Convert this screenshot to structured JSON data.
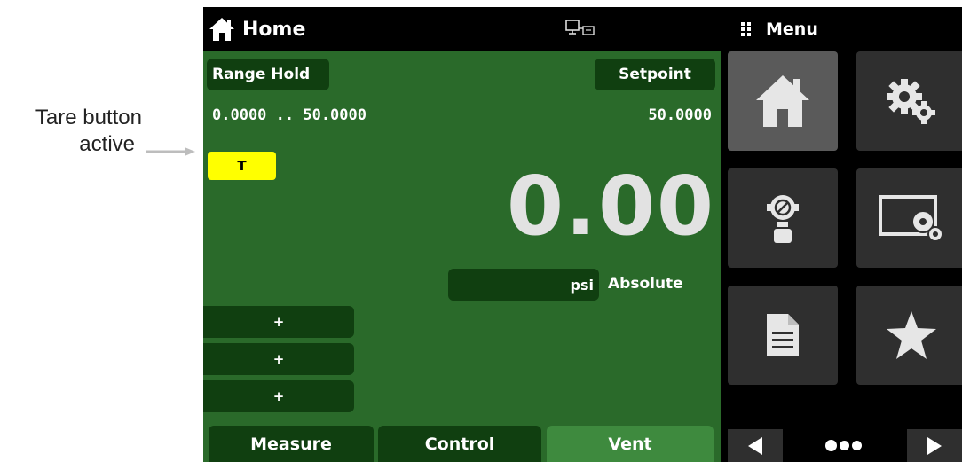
{
  "annotation": {
    "line1": "Tare button",
    "line2": "active"
  },
  "topbar": {
    "home_label": "Home",
    "home_icon": "home-icon",
    "network_icon": "network-icon",
    "menu_icon": "grid-dots-icon",
    "menu_label": "Menu"
  },
  "main": {
    "range_hold_label": "Range Hold",
    "setpoint_label": "Setpoint",
    "range_values": "0.0000 .. 50.0000",
    "setpoint_value": "50.0000",
    "tare_label": "T",
    "reading": "0.00",
    "unit": "psi",
    "mode": "Absolute",
    "plus_labels": [
      "+",
      "+",
      "+"
    ],
    "tabs": [
      {
        "label": "Measure"
      },
      {
        "label": "Control"
      },
      {
        "label": "Vent"
      }
    ]
  },
  "menu_tiles": [
    {
      "icon": "home-icon",
      "active": true
    },
    {
      "icon": "gears-icon"
    },
    {
      "icon": "sensor-icon"
    },
    {
      "icon": "display-settings-icon"
    },
    {
      "icon": "document-icon"
    },
    {
      "icon": "star-icon"
    }
  ],
  "pager": {
    "prev_icon": "triangle-left-icon",
    "next_icon": "triangle-right-icon",
    "dots_icon": "page-dots-icon"
  },
  "colors": {
    "panel_green": "#2a6a2a",
    "dark_green": "#103f10",
    "vent_green": "#3e8a3e",
    "tare_yellow": "#ffff00",
    "tile_gray": "#2f2f2f",
    "tile_active": "#5a5a5a"
  }
}
